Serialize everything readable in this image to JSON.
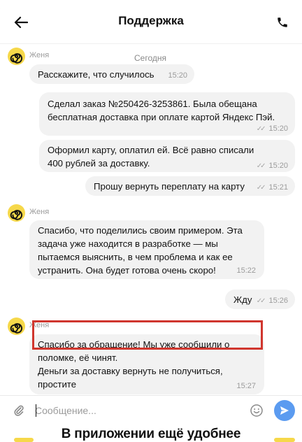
{
  "header": {
    "title": "Поддержка"
  },
  "chat": {
    "date_divider": "Сегодня",
    "messages": [
      {
        "sender": "Женя",
        "text": "Расскажите, что случилось",
        "time": "15:20"
      },
      {
        "text": "Сделал заказ №250426-3253861. Была обещана бесплатная доставка при оплате картой Яндекс Пэй.",
        "time": "15:20"
      },
      {
        "text": "Оформил карту, оплатил ей. Всё равно списали 400 рублей за доставку.",
        "time": "15:20"
      },
      {
        "text": "Прошу вернуть переплату на карту",
        "time": "15:21"
      },
      {
        "sender": "Женя",
        "text": "Спасибо, что поделились своим примером. Эта задача уже находится в разработке — мы пытаемся выяснить, в чем проблема и как ее устранить. Она будет готова очень скоро!",
        "time": "15:22"
      },
      {
        "text": "Жду",
        "time": "15:26"
      },
      {
        "sender": "Женя",
        "text": "Спасибо за обращение! Мы уже сообщили о поломке, её чинят.",
        "text_highlighted": "Деньги за доставку вернуть не получиться, простите",
        "time": "15:27"
      }
    ]
  },
  "composer": {
    "placeholder": "Сообщение..."
  },
  "banner": {
    "title": "В приложении ещё удобнее"
  },
  "colors": {
    "accent": "#5b9bf0",
    "avatar": "#f6d84a",
    "bubble": "#f2f2f2",
    "highlight": "#d0362e"
  }
}
